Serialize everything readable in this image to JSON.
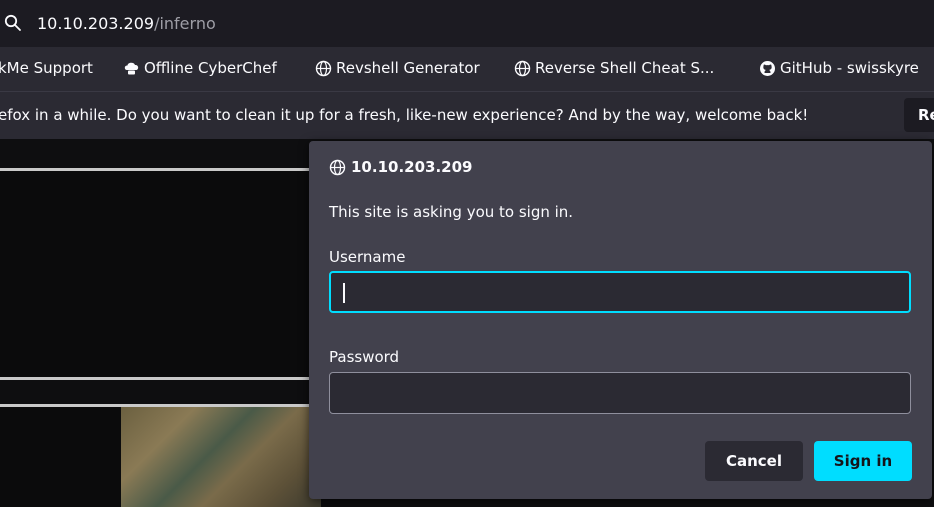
{
  "url_bar": {
    "host": "10.10.203.209",
    "path": "/inferno",
    "search_icon": "search-icon"
  },
  "bookmarks": [
    {
      "label": "kMe Support",
      "icon": ""
    },
    {
      "label": "Offline CyberChef",
      "icon": "chef-hat-icon"
    },
    {
      "label": "Revshell Generator",
      "icon": "globe-icon"
    },
    {
      "label": "Reverse Shell Cheat S...",
      "icon": "globe-icon"
    },
    {
      "label": "GitHub - swisskyre",
      "icon": "github-icon"
    }
  ],
  "notification": {
    "message": "efox in a while. Do you want to clean it up for a fresh, like-new experience? And by the way, welcome back!",
    "button_label": "Re"
  },
  "auth_dialog": {
    "origin": "10.10.203.209",
    "message": "This site is asking you to sign in.",
    "username_label": "Username",
    "username_value": "",
    "password_label": "Password",
    "password_value": "",
    "cancel_label": "Cancel",
    "signin_label": "Sign in"
  },
  "colors": {
    "accent": "#00ddff",
    "dialog_bg": "#42414d",
    "toolbar_bg": "#2b2a33"
  }
}
